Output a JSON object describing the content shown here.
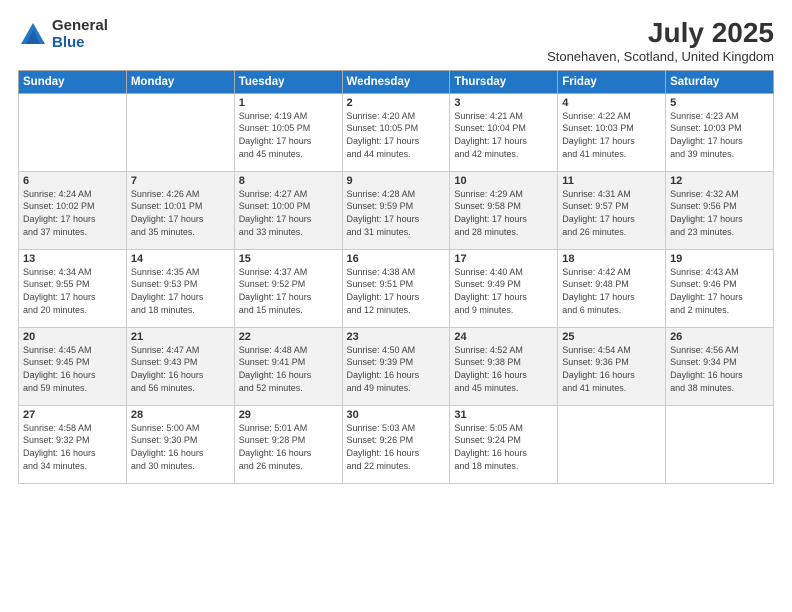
{
  "logo": {
    "general": "General",
    "blue": "Blue"
  },
  "title": "July 2025",
  "location": "Stonehaven, Scotland, United Kingdom",
  "headers": [
    "Sunday",
    "Monday",
    "Tuesday",
    "Wednesday",
    "Thursday",
    "Friday",
    "Saturday"
  ],
  "weeks": [
    [
      {
        "day": "",
        "info": ""
      },
      {
        "day": "",
        "info": ""
      },
      {
        "day": "1",
        "info": "Sunrise: 4:19 AM\nSunset: 10:05 PM\nDaylight: 17 hours\nand 45 minutes."
      },
      {
        "day": "2",
        "info": "Sunrise: 4:20 AM\nSunset: 10:05 PM\nDaylight: 17 hours\nand 44 minutes."
      },
      {
        "day": "3",
        "info": "Sunrise: 4:21 AM\nSunset: 10:04 PM\nDaylight: 17 hours\nand 42 minutes."
      },
      {
        "day": "4",
        "info": "Sunrise: 4:22 AM\nSunset: 10:03 PM\nDaylight: 17 hours\nand 41 minutes."
      },
      {
        "day": "5",
        "info": "Sunrise: 4:23 AM\nSunset: 10:03 PM\nDaylight: 17 hours\nand 39 minutes."
      }
    ],
    [
      {
        "day": "6",
        "info": "Sunrise: 4:24 AM\nSunset: 10:02 PM\nDaylight: 17 hours\nand 37 minutes."
      },
      {
        "day": "7",
        "info": "Sunrise: 4:26 AM\nSunset: 10:01 PM\nDaylight: 17 hours\nand 35 minutes."
      },
      {
        "day": "8",
        "info": "Sunrise: 4:27 AM\nSunset: 10:00 PM\nDaylight: 17 hours\nand 33 minutes."
      },
      {
        "day": "9",
        "info": "Sunrise: 4:28 AM\nSunset: 9:59 PM\nDaylight: 17 hours\nand 31 minutes."
      },
      {
        "day": "10",
        "info": "Sunrise: 4:29 AM\nSunset: 9:58 PM\nDaylight: 17 hours\nand 28 minutes."
      },
      {
        "day": "11",
        "info": "Sunrise: 4:31 AM\nSunset: 9:57 PM\nDaylight: 17 hours\nand 26 minutes."
      },
      {
        "day": "12",
        "info": "Sunrise: 4:32 AM\nSunset: 9:56 PM\nDaylight: 17 hours\nand 23 minutes."
      }
    ],
    [
      {
        "day": "13",
        "info": "Sunrise: 4:34 AM\nSunset: 9:55 PM\nDaylight: 17 hours\nand 20 minutes."
      },
      {
        "day": "14",
        "info": "Sunrise: 4:35 AM\nSunset: 9:53 PM\nDaylight: 17 hours\nand 18 minutes."
      },
      {
        "day": "15",
        "info": "Sunrise: 4:37 AM\nSunset: 9:52 PM\nDaylight: 17 hours\nand 15 minutes."
      },
      {
        "day": "16",
        "info": "Sunrise: 4:38 AM\nSunset: 9:51 PM\nDaylight: 17 hours\nand 12 minutes."
      },
      {
        "day": "17",
        "info": "Sunrise: 4:40 AM\nSunset: 9:49 PM\nDaylight: 17 hours\nand 9 minutes."
      },
      {
        "day": "18",
        "info": "Sunrise: 4:42 AM\nSunset: 9:48 PM\nDaylight: 17 hours\nand 6 minutes."
      },
      {
        "day": "19",
        "info": "Sunrise: 4:43 AM\nSunset: 9:46 PM\nDaylight: 17 hours\nand 2 minutes."
      }
    ],
    [
      {
        "day": "20",
        "info": "Sunrise: 4:45 AM\nSunset: 9:45 PM\nDaylight: 16 hours\nand 59 minutes."
      },
      {
        "day": "21",
        "info": "Sunrise: 4:47 AM\nSunset: 9:43 PM\nDaylight: 16 hours\nand 56 minutes."
      },
      {
        "day": "22",
        "info": "Sunrise: 4:48 AM\nSunset: 9:41 PM\nDaylight: 16 hours\nand 52 minutes."
      },
      {
        "day": "23",
        "info": "Sunrise: 4:50 AM\nSunset: 9:39 PM\nDaylight: 16 hours\nand 49 minutes."
      },
      {
        "day": "24",
        "info": "Sunrise: 4:52 AM\nSunset: 9:38 PM\nDaylight: 16 hours\nand 45 minutes."
      },
      {
        "day": "25",
        "info": "Sunrise: 4:54 AM\nSunset: 9:36 PM\nDaylight: 16 hours\nand 41 minutes."
      },
      {
        "day": "26",
        "info": "Sunrise: 4:56 AM\nSunset: 9:34 PM\nDaylight: 16 hours\nand 38 minutes."
      }
    ],
    [
      {
        "day": "27",
        "info": "Sunrise: 4:58 AM\nSunset: 9:32 PM\nDaylight: 16 hours\nand 34 minutes."
      },
      {
        "day": "28",
        "info": "Sunrise: 5:00 AM\nSunset: 9:30 PM\nDaylight: 16 hours\nand 30 minutes."
      },
      {
        "day": "29",
        "info": "Sunrise: 5:01 AM\nSunset: 9:28 PM\nDaylight: 16 hours\nand 26 minutes."
      },
      {
        "day": "30",
        "info": "Sunrise: 5:03 AM\nSunset: 9:26 PM\nDaylight: 16 hours\nand 22 minutes."
      },
      {
        "day": "31",
        "info": "Sunrise: 5:05 AM\nSunset: 9:24 PM\nDaylight: 16 hours\nand 18 minutes."
      },
      {
        "day": "",
        "info": ""
      },
      {
        "day": "",
        "info": ""
      }
    ]
  ]
}
